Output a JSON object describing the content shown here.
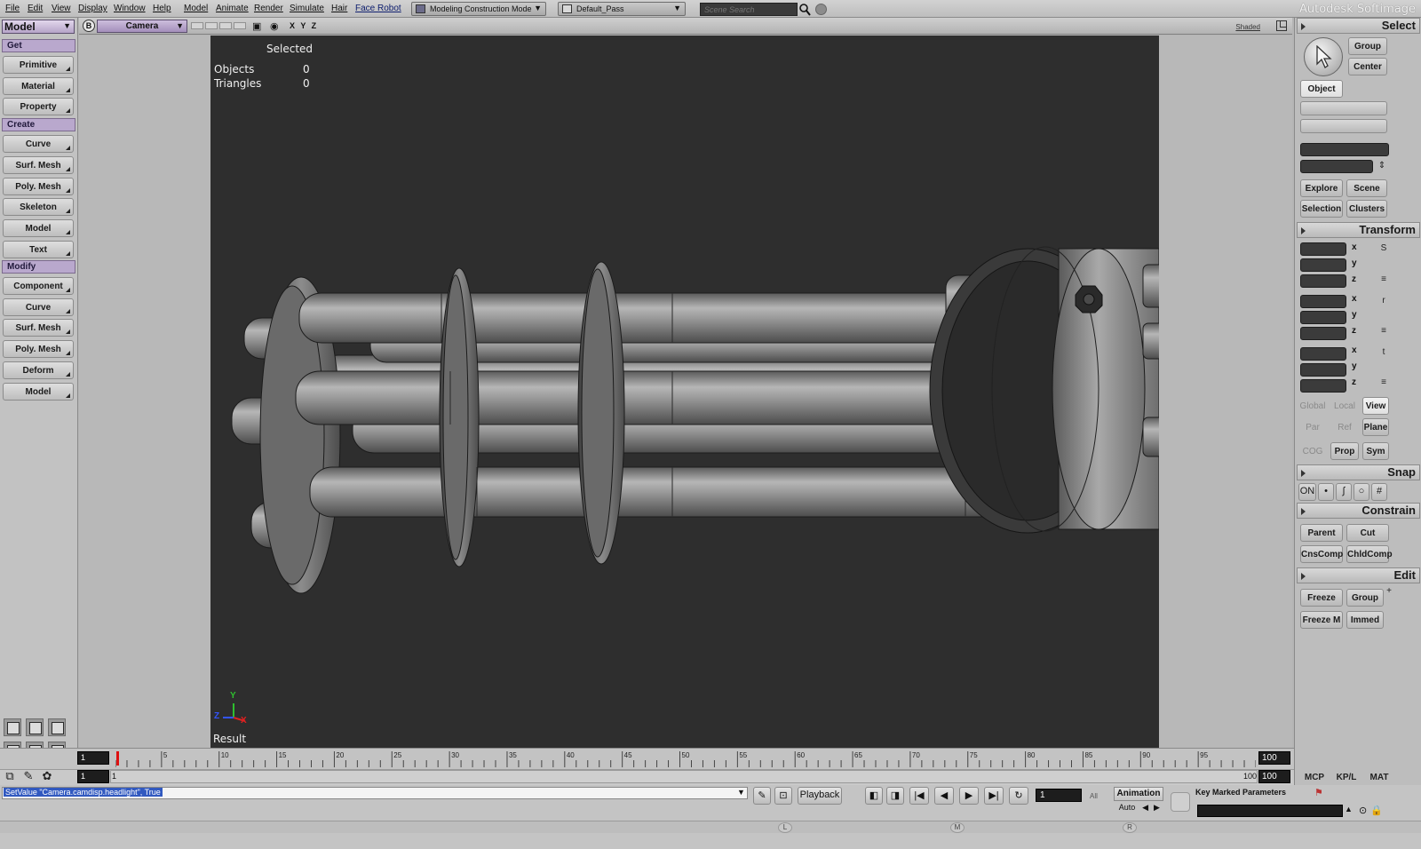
{
  "menubar": {
    "items": [
      "File",
      "Edit",
      "View",
      "Display",
      "Window",
      "Help",
      "Model",
      "Animate",
      "Render",
      "Simulate",
      "Hair",
      "Face Robot"
    ],
    "construction_mode": "Modeling Construction Mode",
    "pass": "Default_Pass",
    "search_placeholder": "Scene Search",
    "brand": "Autodesk Softimage"
  },
  "left_panel": {
    "mode": "Model",
    "sections": [
      {
        "label": "Get",
        "buttons": [
          "Primitive",
          "Material",
          "Property"
        ]
      },
      {
        "label": "Create",
        "buttons": [
          "Curve",
          "Surf. Mesh",
          "Poly. Mesh",
          "Skeleton",
          "Model",
          "Text"
        ]
      },
      {
        "label": "Modify",
        "buttons": [
          "Component",
          "Curve",
          "Surf. Mesh",
          "Poly. Mesh",
          "Deform",
          "Model"
        ]
      }
    ]
  },
  "viewport": {
    "letter": "B",
    "camera": "Camera",
    "axes": "X Y Z",
    "display_mode": "Shaded",
    "hud": {
      "selected_label": "Selected",
      "objects_label": "Objects",
      "objects_value": "0",
      "triangles_label": "Triangles",
      "triangles_value": "0",
      "result_label": "Result"
    },
    "gizmo": {
      "y": "Y",
      "x": "X",
      "z": "Z"
    }
  },
  "right_panel": {
    "select_title": "Select",
    "select_buttons": {
      "group": "Group",
      "center": "Center",
      "object": "Object"
    },
    "explore_buttons": {
      "explore": "Explore",
      "scene": "Scene",
      "selection": "Selection",
      "clusters": "Clusters"
    },
    "transform_title": "Transform",
    "axis_labels": [
      "x",
      "y",
      "z",
      "x",
      "y",
      "z",
      "x",
      "y",
      "z"
    ],
    "transform_icons": [
      "S",
      "r",
      "t"
    ],
    "ref_buttons": {
      "global": "Global",
      "local": "Local",
      "view": "View",
      "par": "Par",
      "ref": "Ref",
      "plane": "Plane",
      "cog": "COG",
      "prop": "Prop",
      "sym": "Sym"
    },
    "snap_title": "Snap",
    "snap_on": "ON",
    "constrain_title": "Constrain",
    "constrain_buttons": {
      "parent": "Parent",
      "cut": "Cut",
      "cnscomp": "CnsComp",
      "chldcomp": "ChldComp"
    },
    "edit_title": "Edit",
    "edit_buttons": {
      "freeze": "Freeze",
      "group": "Group",
      "freeze_m": "Freeze M",
      "immed": "Immed"
    },
    "tabs": [
      "MCP",
      "KP/L",
      "MAT"
    ]
  },
  "timeline": {
    "start": "1",
    "end": "100",
    "current_frame": 1,
    "range_start": "1",
    "range_left": "1",
    "range_right": "100",
    "range_end": "100",
    "ticks": [
      5,
      10,
      15,
      20,
      25,
      30,
      35,
      40,
      45,
      50,
      55,
      60,
      65,
      70,
      75,
      80,
      85,
      90,
      95
    ]
  },
  "bottom": {
    "command": "SetValue \"Camera.camdisp.headlight\", True",
    "playback_label": "Playback",
    "frame_value": "1",
    "all_label": "All",
    "animation_label": "Animation",
    "auto_label": "Auto",
    "key_marked_label": "Key Marked Parameters",
    "mouse_buttons": [
      "L",
      "M",
      "R"
    ]
  }
}
